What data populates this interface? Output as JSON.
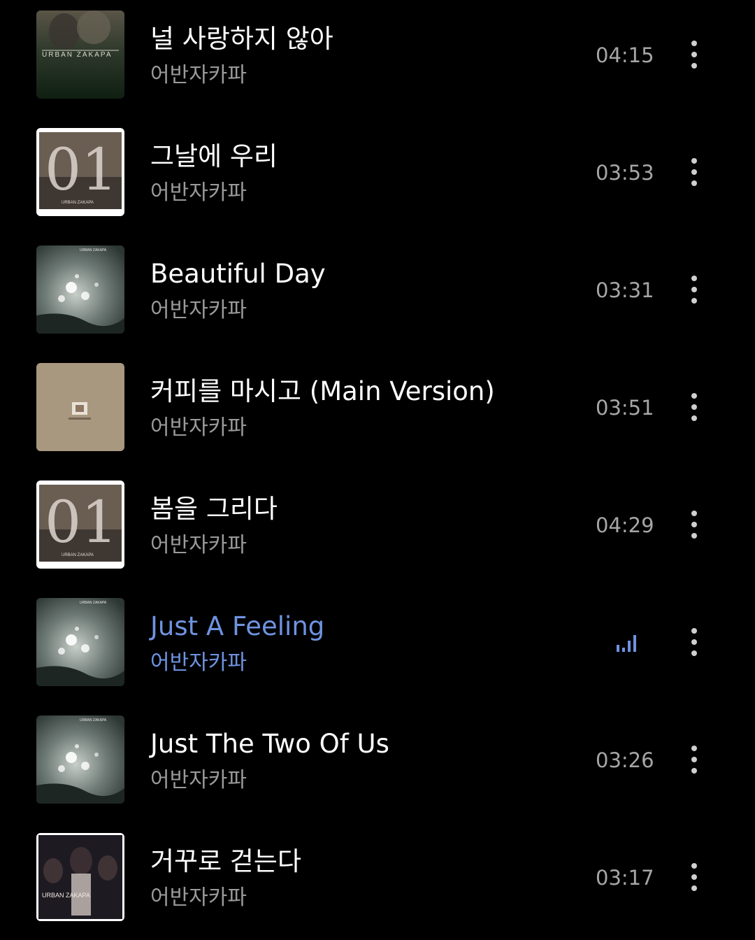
{
  "tracks": [
    {
      "title": "널 사랑하지 않아",
      "artist": "어반자카파",
      "duration": "04:15",
      "art_icon": "album-urban-zakapa-dark"
    },
    {
      "title": "그날에 우리",
      "artist": "어반자카파",
      "duration": "03:53",
      "art_icon": "album-01"
    },
    {
      "title": "Beautiful Day",
      "artist": "어반자카파",
      "duration": "03:31",
      "art_icon": "album-sea-lights"
    },
    {
      "title": "커피를 마시고 (Main Version)",
      "artist": "어반자카파",
      "duration": "03:51",
      "art_icon": "album-three-people"
    },
    {
      "title": "봄을 그리다",
      "artist": "어반자카파",
      "duration": "04:29",
      "art_icon": "album-01"
    },
    {
      "title": "Just A Feeling",
      "artist": "어반자카파",
      "duration": "",
      "art_icon": "album-sea-lights",
      "now_playing": true
    },
    {
      "title": "Just The Two Of Us",
      "artist": "어반자카파",
      "duration": "03:26",
      "art_icon": "album-sea-lights"
    },
    {
      "title": "거꾸로 걷는다",
      "artist": "어반자카파",
      "duration": "03:17",
      "art_icon": "album-urban-zakapa-portrait"
    }
  ],
  "icons": {
    "more": "more-vertical-icon",
    "now_playing": "equalizer-icon"
  },
  "colors": {
    "background": "#000000",
    "title": "#ffffff",
    "artist": "#9a9a9a",
    "duration": "#a6a6a6",
    "accent_playing": "#6f93e0"
  }
}
